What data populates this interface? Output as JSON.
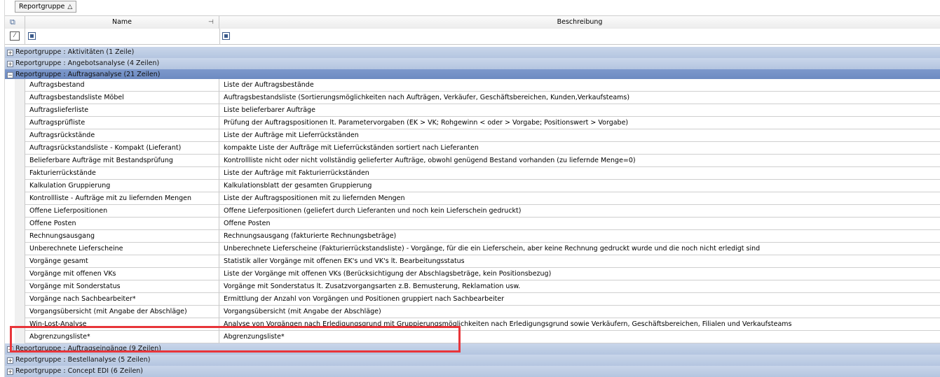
{
  "group_panel": {
    "chip_label": "Reportgruppe",
    "sort_icon": "sort-ascending-icon"
  },
  "columns": {
    "name": "Name",
    "description": "Beschreibung"
  },
  "groups_before": [
    {
      "label": "Reportgruppe : Aktivitäten (1 Zeile)",
      "toggle": "+"
    },
    {
      "label": "Reportgruppe : Angebotsanalyse (4 Zeilen)",
      "toggle": "+"
    },
    {
      "label": "Reportgruppe : Auftragsanalyse (21 Zeilen)",
      "toggle": "−"
    }
  ],
  "rows": [
    {
      "name": "Auftragsbestand",
      "desc": "Liste der Auftragsbestände"
    },
    {
      "name": "Auftragsbestandsliste Möbel",
      "desc": "Auftragsbestandsliste (Sortierungsmöglichkeiten nach Aufträgen, Verkäufer, Geschäftsbereichen, Kunden,Verkaufsteams)"
    },
    {
      "name": "Auftragslieferliste",
      "desc": "Liste belieferbarer Aufträge"
    },
    {
      "name": "Auftragsprüfliste",
      "desc": "Prüfung der Auftragspositionen lt. Parametervorgaben (EK > VK; Rohgewinn < oder > Vorgabe; Positionswert > Vorgabe)"
    },
    {
      "name": "Auftragsrückstände",
      "desc": "Liste der Aufträge mit Lieferrückständen"
    },
    {
      "name": "Auftragsrückstandsliste - Kompakt (Lieferant)",
      "desc": "kompakte Liste der Aufträge mit Lieferrückständen sortiert nach Lieferanten"
    },
    {
      "name": "Belieferbare Aufträge mit Bestandsprüfung",
      "desc": "Kontrollliste nicht oder nicht vollständig gelieferter Aufträge, obwohl genügend Bestand vorhanden (zu liefernde Menge=0)"
    },
    {
      "name": "Fakturierrückstände",
      "desc": "Liste der Aufträge mit Fakturierrückständen"
    },
    {
      "name": "Kalkulation Gruppierung",
      "desc": "Kalkulationsblatt der gesamten Gruppierung"
    },
    {
      "name": "Kontrollliste - Aufträge mit zu liefernden Mengen",
      "desc": "Liste der Auftragspositionen mit zu liefernden Mengen"
    },
    {
      "name": "Offene Lieferpositionen",
      "desc": "Offene Lieferpositionen (geliefert durch Lieferanten und noch kein Lieferschein gedruckt)"
    },
    {
      "name": "Offene Posten",
      "desc": "Offene Posten"
    },
    {
      "name": "Rechnungsausgang",
      "desc": "Rechnungsausgang (fakturierte Rechnungsbeträge)"
    },
    {
      "name": "Unberechnete Lieferscheine",
      "desc": "Unberechnete Lieferscheine (Fakturierrückstandsliste) - Vorgänge, für die ein Lieferschein, aber keine Rechnung gedruckt wurde und die noch nicht erledigt sind"
    },
    {
      "name": "Vorgänge gesamt",
      "desc": "Statistik aller Vorgänge mit offenen EK's und VK's lt. Bearbeitungsstatus"
    },
    {
      "name": "Vorgänge mit offenen VKs",
      "desc": "Liste der Vorgänge mit offenen VKs (Berücksichtigung der Abschlagsbeträge, kein Positionsbezug)"
    },
    {
      "name": "Vorgänge mit Sonderstatus",
      "desc": "Vorgänge mit Sonderstatus lt. Zusatzvorgangsarten z.B. Bemusterung, Reklamation usw."
    },
    {
      "name": "Vorgänge nach Sachbearbeiter*",
      "desc": "Ermittlung der Anzahl von Vorgängen und Positionen gruppiert nach Sachbearbeiter"
    },
    {
      "name": "Vorgangsübersicht (mit Angabe der Abschläge)",
      "desc": "Vorgangsübersicht (mit Angabe der Abschläge)"
    },
    {
      "name": "Win-Lost-Analyse",
      "desc": "Analyse von Vorgängen nach Erledigungsgrund mit Gruppierungsmöglichkeiten nach Erledigungsgrund sowie Verkäufern, Geschäftsbereichen, Filialen und Verkaufsteams"
    },
    {
      "name": "Abgrenzungsliste*",
      "desc": "Abgrenzungsliste*"
    }
  ],
  "groups_after": [
    {
      "label": "Reportgruppe : Auftragseingänge (9 Zeilen)",
      "toggle": "+"
    },
    {
      "label": "Reportgruppe : Bestellanalyse (5 Zeilen)",
      "toggle": "+"
    },
    {
      "label": "Reportgruppe : Concept EDI (6 Zeilen)",
      "toggle": "+"
    }
  ],
  "colors": {
    "highlight": "#e8353a",
    "group_collapsed": "#c2d1e8",
    "group_expanded": "#7592c7"
  }
}
